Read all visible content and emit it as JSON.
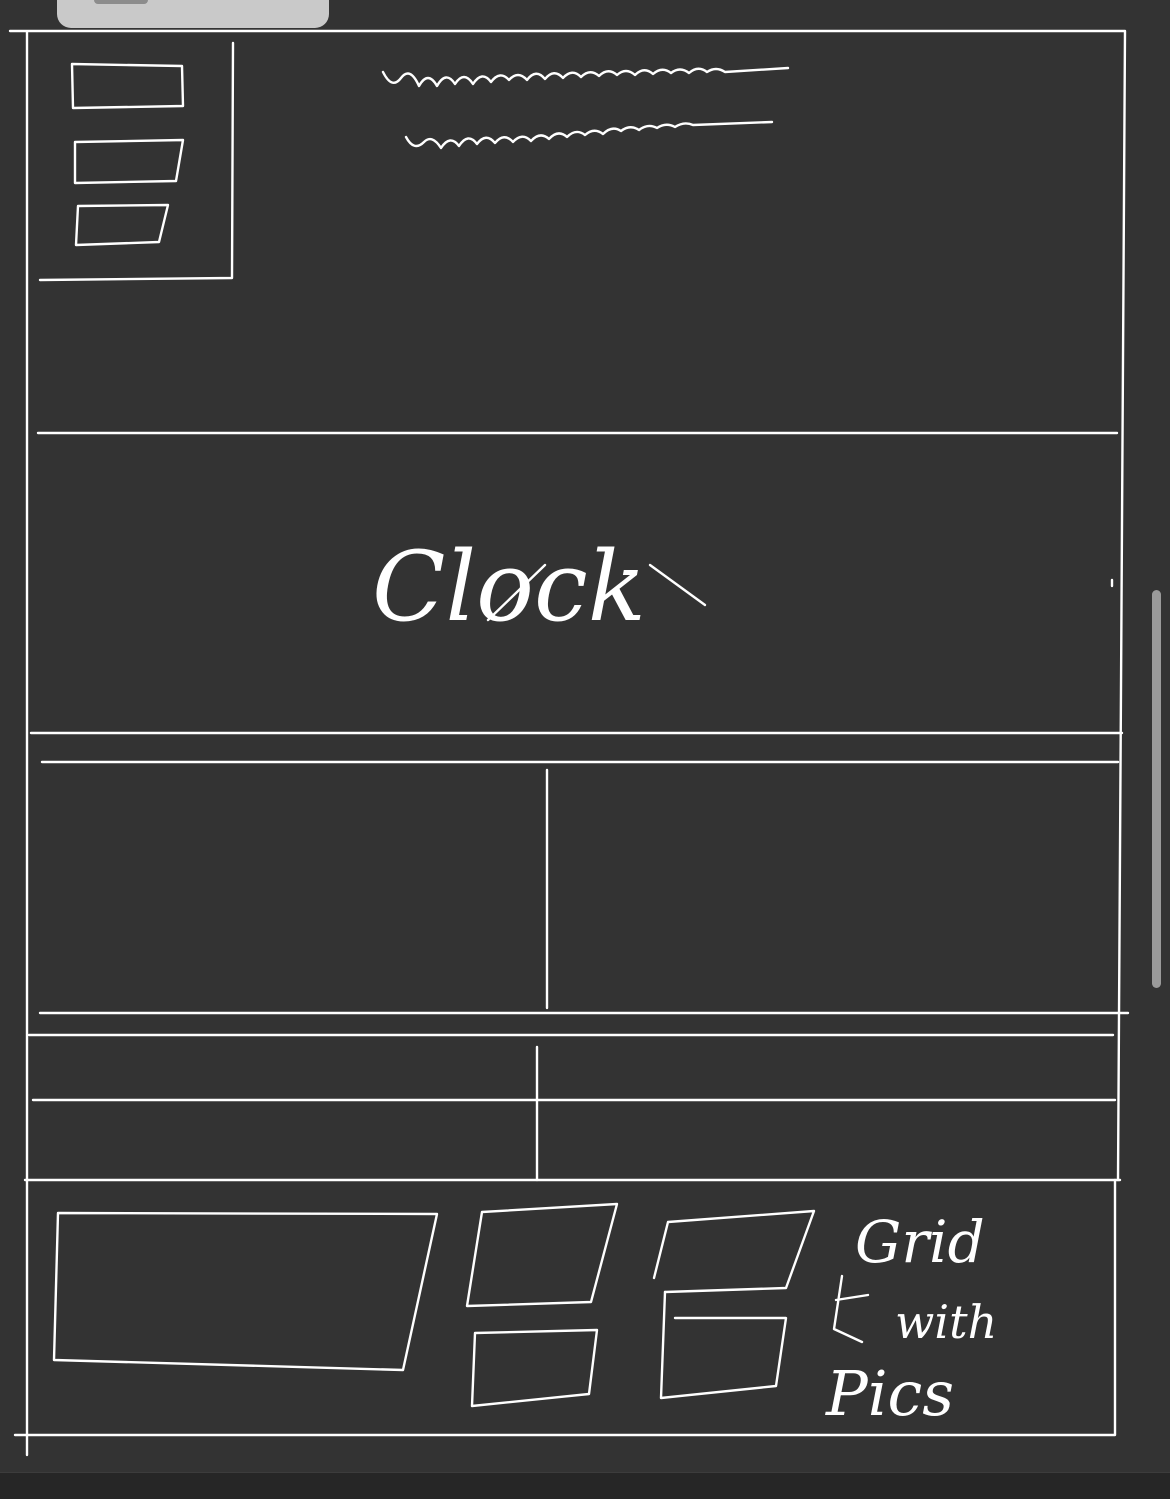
{
  "sketch": {
    "clock_label": "Clock",
    "grid_label_lines": [
      "Grid",
      "with",
      "Pics"
    ]
  },
  "colors": {
    "background": "#333333",
    "ink": "#ffffff",
    "scrollbar": "#9a9a9a"
  },
  "icons": {
    "tab": "browser-tab-chip",
    "scrollbar": "scrollbar-thumb"
  }
}
